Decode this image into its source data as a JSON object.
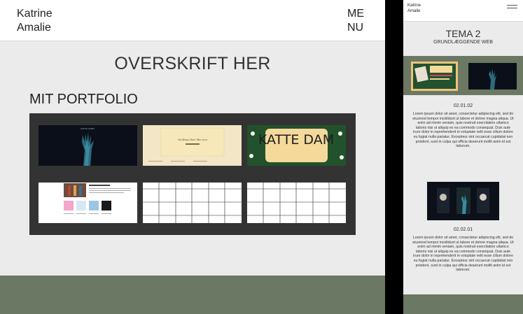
{
  "desktop": {
    "brand": "Katrine\nAmalie",
    "menu": "ME\nNU",
    "headline": "OVERSKRIFT HER",
    "section_title": "MIT PORTFOLIO",
    "tiles": [
      {
        "name": "portfolio-tile-dark-hand",
        "caption": "KATTE DAMM"
      },
      {
        "name": "portfolio-tile-cream-site",
        "caption": "clicking that like you"
      },
      {
        "name": "portfolio-tile-katte-dam",
        "caption": "KATTE DAM"
      },
      {
        "name": "portfolio-tile-web-page"
      },
      {
        "name": "portfolio-tile-grid-empty"
      },
      {
        "name": "portfolio-tile-grid-empty-2"
      }
    ],
    "colors": {
      "accent": "#6b7863",
      "panel": "#333333",
      "background": "#ebebeb"
    }
  },
  "mobile": {
    "brand": "Katrine\nAmalie",
    "title": "TEMA 2",
    "subtitle": "GRUNDLÆGGENDE WEB",
    "date1": "02.01.02",
    "date2": "02.02.01",
    "lorem1": "Lorem ipsum dolor sit amet, consectetur adipiscing elit, sed do eiusmod tempor incididunt ut labore et dolore magna aliqua. Ut enim ad minim veniam, quis nostrud exercitation ullamco laboris nisi ut aliquip ex ea commodo consequat. Duis aute irure dolor in reprehenderit in voluptate velit esse cillum dolore eu fugiat nulla pariatur. Excepteur sint occaecat cupidatat non proident, sunt in culpa qui officia deserunt mollit anim id est laborum.",
    "lorem2": "Lorem ipsum dolor sit amet, consectetur adipiscing elit, sed do eiusmod tempor incididunt ut labore et dolore magna aliqua. Ut enim ad minim veniam, quis nostrud exercitation ullamco laboris nisi ut aliquip ex ea commodo consequat. Duis aute irure dolor in reprehenderit in voluptate velit esse cillum dolore eu fugiat nulla pariatur. Excepteur sint occaecat cupidatat non proident, sunt in culpa qui officia deserunt mollit anim id est laborum.",
    "icons": {
      "menu": "hamburger-icon"
    }
  }
}
